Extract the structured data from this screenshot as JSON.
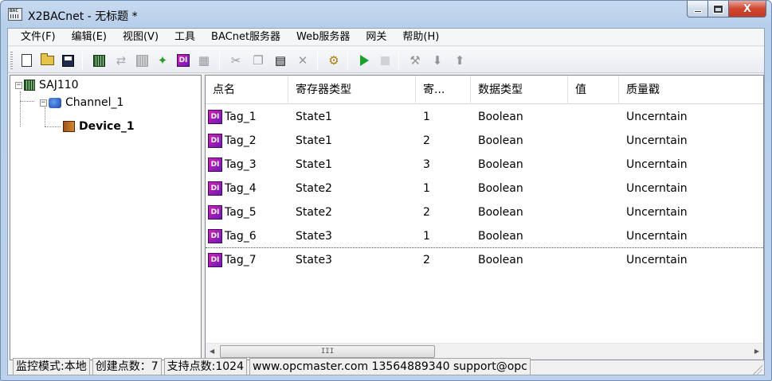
{
  "window": {
    "app_icon_text": "BAC",
    "title": "X2BACnet - 无标题 *",
    "close_glyph": "X"
  },
  "menu": {
    "items": [
      "文件(F)",
      "编辑(E)",
      "视图(V)",
      "工具",
      "BACnet服务器",
      "Web服务器",
      "网关",
      "帮助(H)"
    ]
  },
  "toolbar": {
    "buttons": [
      {
        "icon": "new-file-icon",
        "enabled": true
      },
      {
        "icon": "open-folder-icon",
        "enabled": true
      },
      {
        "icon": "save-icon",
        "enabled": true
      },
      {
        "icon": "new-device-icon",
        "enabled": true
      },
      {
        "icon": "new-channel-icon",
        "enabled": false
      },
      {
        "icon": "device-properties-icon",
        "enabled": false
      },
      {
        "icon": "import-icon",
        "enabled": true
      },
      {
        "icon": "new-tag-icon",
        "enabled": true
      },
      {
        "icon": "tag-properties-icon",
        "enabled": false
      },
      {
        "icon": "cut-icon",
        "enabled": false
      },
      {
        "icon": "copy-icon",
        "enabled": false
      },
      {
        "icon": "paste-icon",
        "enabled": true
      },
      {
        "icon": "delete-icon",
        "enabled": false
      },
      {
        "icon": "monitor-icon",
        "enabled": true
      },
      {
        "icon": "run-icon",
        "enabled": true
      },
      {
        "icon": "stop-icon",
        "enabled": false
      },
      {
        "icon": "tools-icon",
        "enabled": false
      },
      {
        "icon": "load-icon",
        "enabled": false
      },
      {
        "icon": "upload-icon",
        "enabled": false
      }
    ],
    "tag_glyph": "DI"
  },
  "tree": {
    "root": {
      "label": "SAJ110",
      "expander": "−"
    },
    "channel": {
      "label": "Channel_1",
      "expander": "−"
    },
    "device": {
      "label": "Device_1"
    }
  },
  "list": {
    "columns": [
      "点名",
      "寄存器类型",
      "寄...",
      "数据类型",
      "值",
      "质量戳"
    ],
    "rows": [
      {
        "name": "Tag_1",
        "register": "State1",
        "addr": "1",
        "dtype": "Boolean",
        "value": "",
        "quality": "Uncerntain"
      },
      {
        "name": "Tag_2",
        "register": "State1",
        "addr": "2",
        "dtype": "Boolean",
        "value": "",
        "quality": "Uncerntain"
      },
      {
        "name": "Tag_3",
        "register": "State1",
        "addr": "3",
        "dtype": "Boolean",
        "value": "",
        "quality": "Uncerntain"
      },
      {
        "name": "Tag_4",
        "register": "State2",
        "addr": "1",
        "dtype": "Boolean",
        "value": "",
        "quality": "Uncerntain"
      },
      {
        "name": "Tag_5",
        "register": "State2",
        "addr": "2",
        "dtype": "Boolean",
        "value": "",
        "quality": "Uncerntain"
      },
      {
        "name": "Tag_6",
        "register": "State3",
        "addr": "1",
        "dtype": "Boolean",
        "value": "",
        "quality": "Uncerntain"
      },
      {
        "name": "Tag_7",
        "register": "State3",
        "addr": "2",
        "dtype": "Boolean",
        "value": "",
        "quality": "Uncerntain"
      }
    ],
    "scroll_thumb_glyph": "III",
    "scroll_left": "◀",
    "scroll_right": "▶"
  },
  "status": {
    "panes": [
      "监控模式:本地",
      "创建点数：7",
      "支持点数:1024",
      "www.opcmaster.com 13564889340 support@opc"
    ]
  }
}
